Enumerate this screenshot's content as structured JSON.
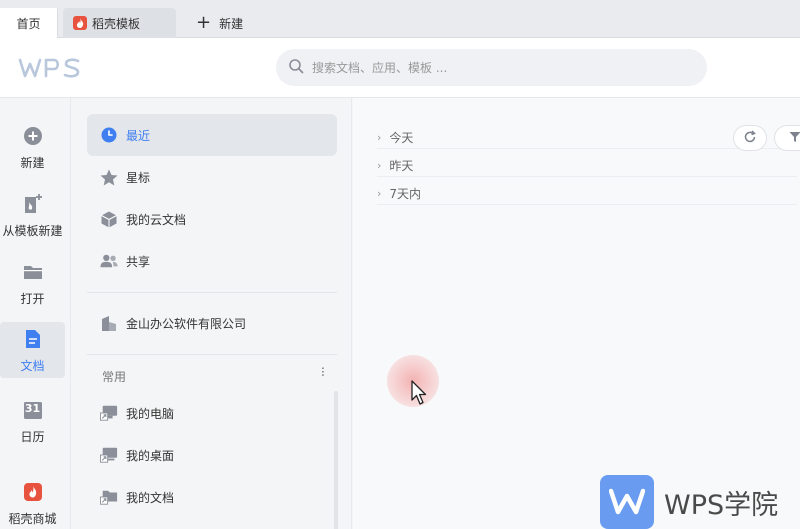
{
  "tabs": [
    {
      "label": "首页"
    },
    {
      "label": "稻壳模板"
    },
    {
      "label": "新建"
    }
  ],
  "header": {
    "logo": "WPS",
    "search_placeholder": "搜索文档、应用、模板 ..."
  },
  "rail": {
    "items": [
      {
        "label": "新建",
        "icon": "plus-circle-icon"
      },
      {
        "label": "从模板新建",
        "icon": "template-new-icon"
      },
      {
        "label": "打开",
        "icon": "folder-icon"
      },
      {
        "label": "文档",
        "icon": "document-icon",
        "active": true
      },
      {
        "label": "日历",
        "icon": "calendar-icon",
        "day": "31"
      },
      {
        "label": "稻壳商城",
        "icon": "daoke-icon"
      }
    ]
  },
  "nav": {
    "items": [
      {
        "label": "最近",
        "icon": "clock-icon",
        "active": true
      },
      {
        "label": "星标",
        "icon": "star-icon"
      },
      {
        "label": "我的云文档",
        "icon": "cloud-box-icon"
      },
      {
        "label": "共享",
        "icon": "people-icon"
      }
    ],
    "company": {
      "label": "金山办公软件有限公司",
      "icon": "building-icon"
    },
    "section_label": "常用",
    "common_items": [
      {
        "label": "我的电脑",
        "icon": "computer-shortcut-icon"
      },
      {
        "label": "我的桌面",
        "icon": "desktop-shortcut-icon"
      },
      {
        "label": "我的文档",
        "icon": "folder-shortcut-icon"
      }
    ]
  },
  "main": {
    "groups": [
      {
        "label": "今天"
      },
      {
        "label": "昨天"
      },
      {
        "label": "7天内"
      }
    ]
  },
  "watermark": {
    "text": "WPS学院"
  },
  "colors": {
    "accent": "#3f7ff0",
    "brand_red": "#e8533f"
  }
}
